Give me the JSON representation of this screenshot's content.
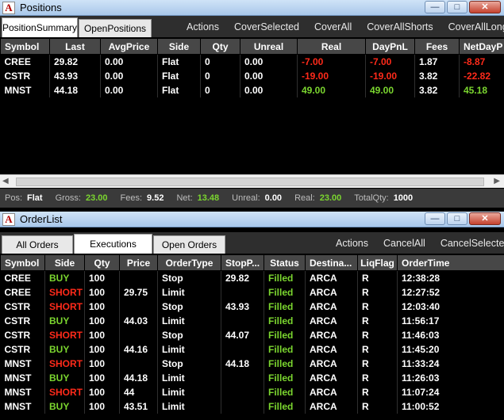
{
  "positions_window": {
    "title": "Positions",
    "tabs": [
      {
        "label": "PositionSummary",
        "active": true
      },
      {
        "label": "OpenPositions",
        "active": false
      }
    ],
    "actions": [
      "Actions",
      "CoverSelected",
      "CoverAll",
      "CoverAllShorts",
      "CoverAllLongs"
    ],
    "columns": [
      "Symbol",
      "Last",
      "AvgPrice",
      "Side",
      "Qty",
      "Unreal",
      "Real",
      "DayPnL",
      "Fees",
      "NetDayP"
    ],
    "rows": [
      [
        "CREE",
        "29.82",
        "0.00",
        "Flat",
        "0",
        "0.00",
        "-7.00",
        "-7.00",
        "1.87",
        "-8.87"
      ],
      [
        "CSTR",
        "43.93",
        "0.00",
        "Flat",
        "0",
        "0.00",
        "-19.00",
        "-19.00",
        "3.82",
        "-22.82"
      ],
      [
        "MNST",
        "44.18",
        "0.00",
        "Flat",
        "0",
        "0.00",
        "49.00",
        "49.00",
        "3.82",
        "45.18"
      ]
    ],
    "status": {
      "pos_label": "Pos:",
      "pos": "Flat",
      "gross_label": "Gross:",
      "gross": "23.00",
      "fees_label": "Fees:",
      "fees": "9.52",
      "net_label": "Net:",
      "net": "13.48",
      "unreal_label": "Unreal:",
      "unreal": "0.00",
      "real_label": "Real:",
      "real": "23.00",
      "totalqty_label": "TotalQty:",
      "totalqty": "1000"
    }
  },
  "orderlist_window": {
    "title": "OrderList",
    "tabs": [
      {
        "label": "All Orders",
        "active": false
      },
      {
        "label": "Executions",
        "active": true
      },
      {
        "label": "Open Orders",
        "active": false
      }
    ],
    "actions": [
      "Actions",
      "CancelAll",
      "CancelSelected"
    ],
    "columns": [
      "Symbol",
      "Side",
      "Qty",
      "Price",
      "OrderType",
      "StopP...",
      "Status",
      "Destina...",
      "LiqFlag",
      "OrderTime"
    ],
    "rows": [
      [
        "CREE",
        "BUY",
        "100",
        "",
        "Stop",
        "29.82",
        "Filled",
        "ARCA",
        "R",
        "12:38:28"
      ],
      [
        "CREE",
        "SHORT",
        "100",
        "29.75",
        "Limit",
        "",
        "Filled",
        "ARCA",
        "R",
        "12:27:52"
      ],
      [
        "CSTR",
        "SHORT",
        "100",
        "",
        "Stop",
        "43.93",
        "Filled",
        "ARCA",
        "R",
        "12:03:40"
      ],
      [
        "CSTR",
        "BUY",
        "100",
        "44.03",
        "Limit",
        "",
        "Filled",
        "ARCA",
        "R",
        "11:56:17"
      ],
      [
        "CSTR",
        "SHORT",
        "100",
        "",
        "Stop",
        "44.07",
        "Filled",
        "ARCA",
        "R",
        "11:46:03"
      ],
      [
        "CSTR",
        "BUY",
        "100",
        "44.16",
        "Limit",
        "",
        "Filled",
        "ARCA",
        "R",
        "11:45:20"
      ],
      [
        "MNST",
        "SHORT",
        "100",
        "",
        "Stop",
        "44.18",
        "Filled",
        "ARCA",
        "R",
        "11:33:24"
      ],
      [
        "MNST",
        "BUY",
        "100",
        "44.18",
        "Limit",
        "",
        "Filled",
        "ARCA",
        "R",
        "11:26:03"
      ],
      [
        "MNST",
        "SHORT",
        "100",
        "44",
        "Limit",
        "",
        "Filled",
        "ARCA",
        "R",
        "11:07:24"
      ],
      [
        "MNST",
        "BUY",
        "100",
        "43.51",
        "Limit",
        "",
        "Filled",
        "ARCA",
        "R",
        "11:00:52"
      ]
    ]
  },
  "colors": {
    "positive": "#7bd62f",
    "negative": "#ff2a1a",
    "header_bg": "#474747"
  },
  "icons": [
    "app-logo-icon",
    "minimize-icon",
    "maximize-icon",
    "close-icon"
  ]
}
